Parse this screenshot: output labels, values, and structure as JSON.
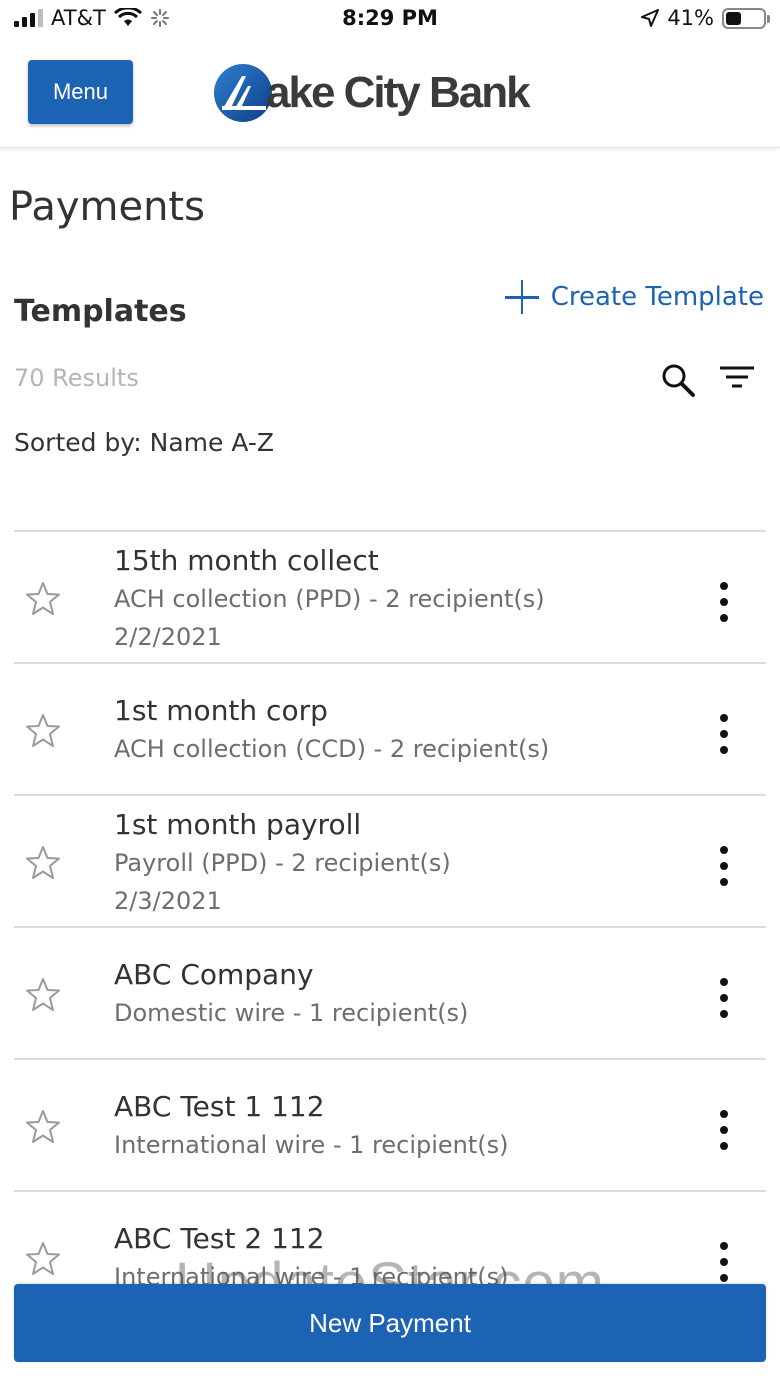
{
  "status_bar": {
    "carrier": "AT&T",
    "time": "8:29 PM",
    "battery": "41%",
    "battery_level": 0.41
  },
  "header": {
    "menu_label": "Menu",
    "logo_text": "ake City Bank",
    "brand_color": "#1c63b3"
  },
  "page": {
    "title": "Payments",
    "section_title": "Templates",
    "create_template_label": "Create Template",
    "results": "70 Results",
    "sorted_by": "Sorted by: Name A-Z"
  },
  "templates": [
    {
      "name": "15th month collect",
      "detail": "ACH collection (PPD) - 2 recipient(s)",
      "date": "2/2/2021"
    },
    {
      "name": "1st month corp",
      "detail": "ACH collection (CCD) - 2 recipient(s)",
      "date": ""
    },
    {
      "name": "1st month payroll",
      "detail": "Payroll (PPD) - 2 recipient(s)",
      "date": "2/3/2021"
    },
    {
      "name": "ABC Company",
      "detail": "Domestic wire - 1 recipient(s)",
      "date": ""
    },
    {
      "name": "ABC Test 1 112",
      "detail": "International wire - 1 recipient(s)",
      "date": ""
    },
    {
      "name": "ABC Test 2 112",
      "detail": "International wire - 1 recipient(s)",
      "date": ""
    }
  ],
  "watermark": "UpdateStar.com",
  "footer": {
    "new_payment_label": "New Payment"
  }
}
